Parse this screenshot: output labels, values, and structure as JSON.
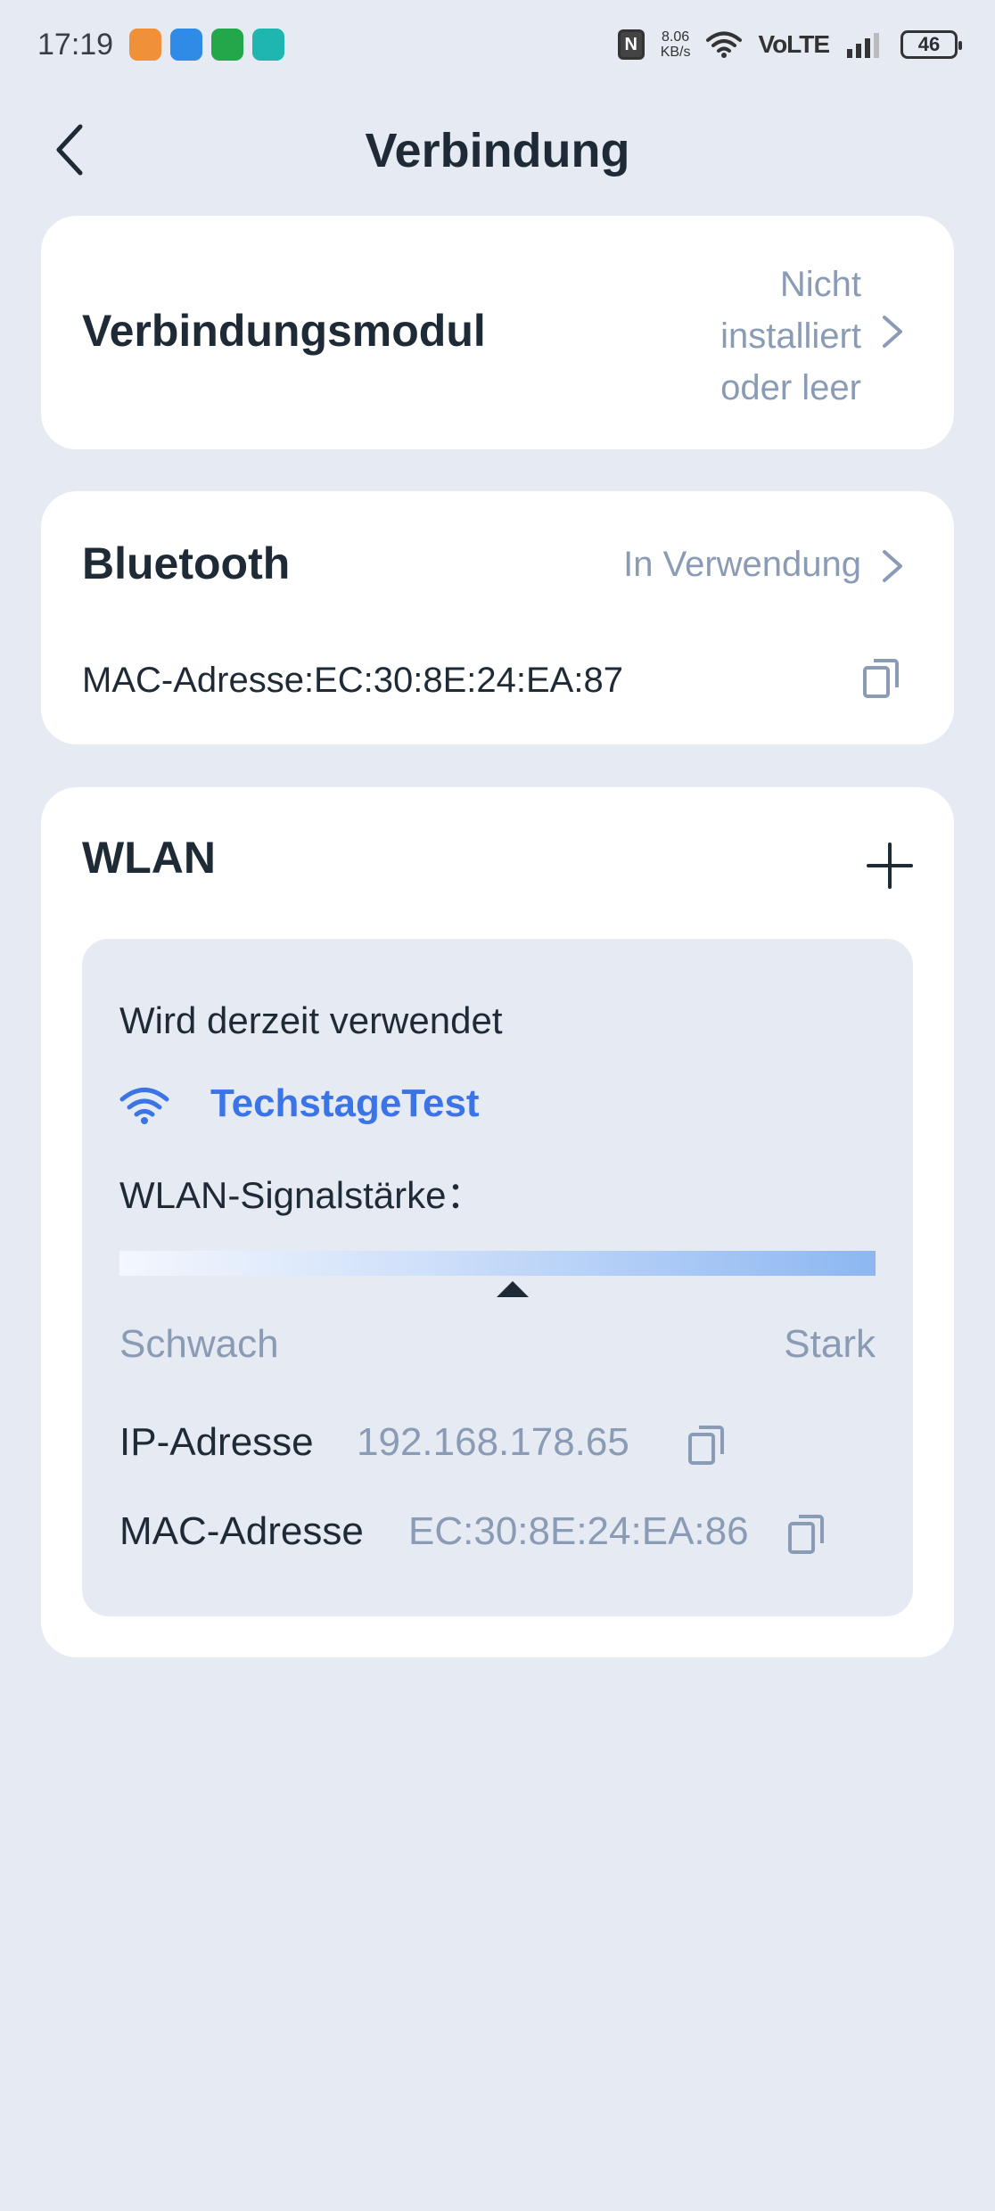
{
  "status_bar": {
    "time": "17:19",
    "net_speed_value": "8.06",
    "net_speed_unit": "KB/s",
    "network_label": "VoLTE",
    "battery": "46",
    "app_icon_colors": [
      "#f0913a",
      "#2f8be6",
      "#22a84a",
      "#1fb6b0"
    ]
  },
  "header": {
    "title": "Verbindung"
  },
  "module": {
    "title": "Verbindungsmodul",
    "status_lines": [
      "Nicht",
      "installiert",
      "oder leer"
    ]
  },
  "bluetooth": {
    "title": "Bluetooth",
    "status": "In Verwendung",
    "mac": "MAC-Adresse:EC:30:8E:24:EA:87"
  },
  "wlan": {
    "title": "WLAN",
    "current_label": "Wird derzeit verwendet",
    "ssid": "TechstageTest",
    "signal_label": "WLAN-Signalstärke：",
    "signal_level": 0.52,
    "weak_label": "Schwach",
    "strong_label": "Stark",
    "ip_label": "IP-Adresse",
    "ip_value": "192.168.178.65",
    "mac_label": "MAC-Adresse",
    "mac_value": "EC:30:8E:24:EA:86"
  },
  "colors": {
    "accent": "#3a74e6",
    "muted": "#8a9bb5",
    "background": "#e6eaf2"
  }
}
